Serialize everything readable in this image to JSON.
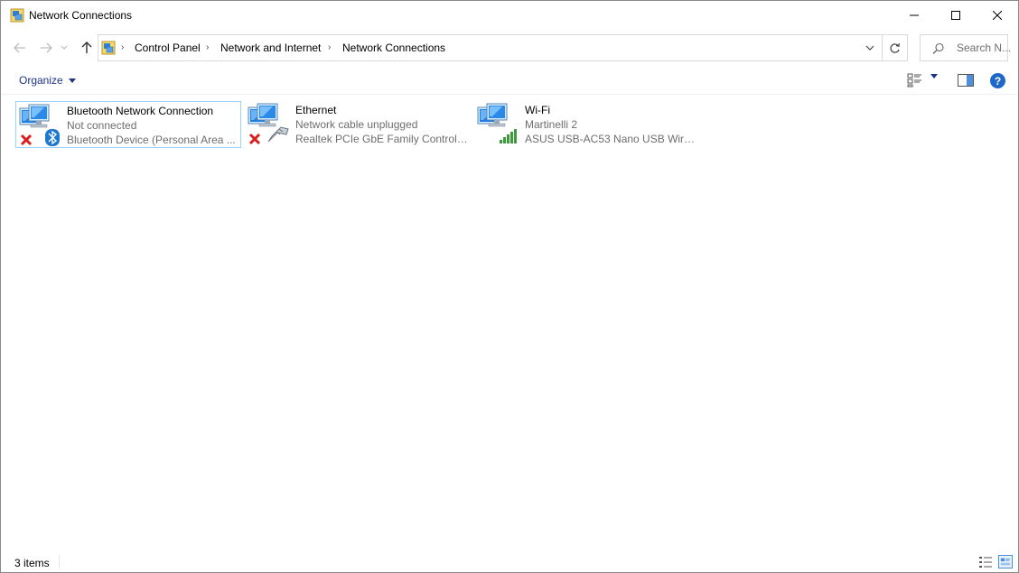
{
  "window": {
    "title": "Network Connections"
  },
  "nav": {
    "breadcrumbs": [
      "Control Panel",
      "Network and Internet",
      "Network Connections"
    ],
    "search_placeholder": "Search N..."
  },
  "toolbar": {
    "organize_label": "Organize",
    "help_label": "?"
  },
  "connections": [
    {
      "name": "Bluetooth Network Connection",
      "status": "Not connected",
      "device": "Bluetooth Device (Personal Area ...",
      "state": "disconnected",
      "type": "bluetooth"
    },
    {
      "name": "Ethernet",
      "status": "Network cable unplugged",
      "device": "Realtek PCIe GbE Family Controller",
      "state": "disconnected",
      "type": "ethernet"
    },
    {
      "name": "Wi-Fi",
      "status": "Martinelli 2",
      "device": "ASUS USB-AC53 Nano USB Wirele...",
      "state": "connected",
      "type": "wifi"
    }
  ],
  "statusbar": {
    "item_count": "3 items"
  },
  "colors": {
    "accent": "#1e3287",
    "selection_border": "#99d1ff",
    "error_red": "#d81e1e",
    "signal_green": "#3c9b3c",
    "bluetooth_blue": "#1e78d2"
  },
  "icons": [
    "network-connections-icon",
    "back-arrow-icon",
    "forward-arrow-icon",
    "up-arrow-icon",
    "refresh-icon",
    "search-icon",
    "view-options-icon",
    "preview-pane-icon",
    "help-icon",
    "monitor-network-icon",
    "red-x-icon",
    "bluetooth-icon",
    "ethernet-plug-icon",
    "signal-bars-icon",
    "details-view-icon",
    "tiles-view-icon"
  ]
}
